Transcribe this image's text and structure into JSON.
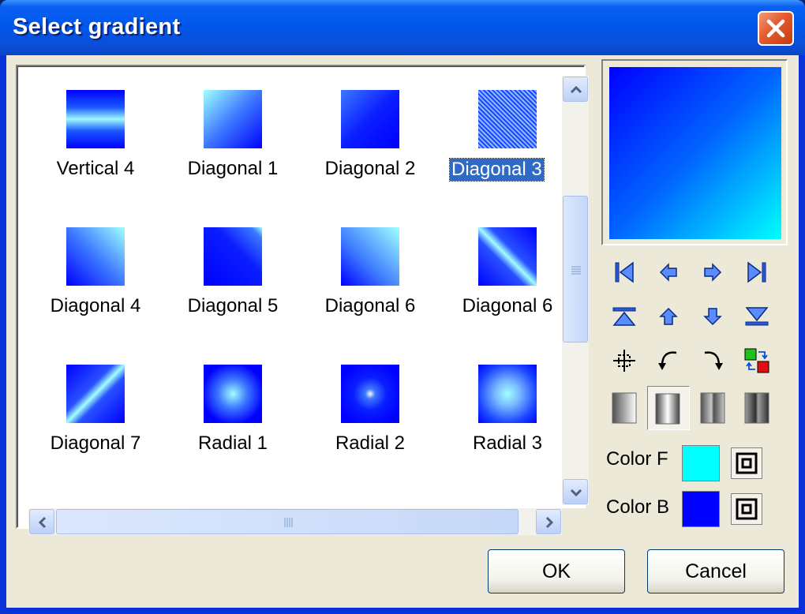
{
  "window": {
    "title": "Select gradient"
  },
  "gallery": {
    "tiles": [
      {
        "label": "Vertical 4",
        "style": "linear-gradient(to bottom,#0000ff 0%,#1a5aff 30%,#a0f8ff 50%,#1a5aff 70%,#0000ff 100%)"
      },
      {
        "label": "Diagonal 1",
        "style": "linear-gradient(135deg,#a0ffff 0%,#3c78ff 50%,#0000ff 100%)"
      },
      {
        "label": "Diagonal 2",
        "style": "linear-gradient(135deg,#3c78ff 0%,#0a1eff 50%,#0000ff 100%)"
      },
      {
        "label": "Diagonal 3",
        "style": "repeating-linear-gradient(45deg,#1a46ff 0px,#1a46ff 2px,#8fb8ff 2px,#8fb8ff 4px)",
        "selected": true
      },
      {
        "label": "Diagonal 4",
        "style": "linear-gradient(45deg,#0000ff 0%,#3c78ff 50%,#a0ffff 100%)"
      },
      {
        "label": "Diagonal 5",
        "style": "linear-gradient(45deg,#0000ff 0%,#0a1eff 60%,#3c78ff 90%,#a0ffff 100%)"
      },
      {
        "label": "Diagonal 6",
        "style": "linear-gradient(45deg,#0000ff 0%,#3c78ff 40%,#a0ffff 100%)"
      },
      {
        "label": "Diagonal 6",
        "style": "linear-gradient(45deg,#0000ff 0%,#2850ff 40%,#a0ffff 50%,#2850ff 60%,#0000ff 100%)"
      },
      {
        "label": "Diagonal 7",
        "style": "linear-gradient(135deg,#0000ff 0%,#2850ff 40%,#a0ffff 50%,#2850ff 60%,#0000ff 100%)"
      },
      {
        "label": "Radial 1",
        "style": "radial-gradient(circle at 50% 50%,#a0ffff 0%,#3c78ff 35%,#0000ff 75%)"
      },
      {
        "label": "Radial 2",
        "style": "radial-gradient(circle at 50% 50%,#ffffff 0%,#3c78ff 12%,#0a1eff 40%,#0000ff 80%)"
      },
      {
        "label": "Radial 3",
        "style": "radial-gradient(circle at 50% 50%,#a0ffff 0%,#7ab8ff 30%,#1a46ff 70%,#0000ff 100%)"
      }
    ]
  },
  "colors": {
    "fore": {
      "label": "Color F",
      "value": "#00ffff"
    },
    "back": {
      "label": "Color B",
      "value": "#0000ff"
    }
  },
  "toolbar": {
    "icons": [
      "first-icon",
      "left-arrow-icon",
      "right-arrow-icon",
      "last-icon",
      "top-icon",
      "up-arrow-icon",
      "down-arrow-icon",
      "bottom-icon",
      "center-icon",
      "rotate-left-icon",
      "rotate-right-icon",
      "swap-colors-icon"
    ],
    "modes": [
      "gradient-mode-1-icon",
      "gradient-mode-2-icon",
      "gradient-mode-3-icon",
      "gradient-mode-4-icon"
    ]
  },
  "buttons": {
    "ok": "OK",
    "cancel": "Cancel"
  }
}
